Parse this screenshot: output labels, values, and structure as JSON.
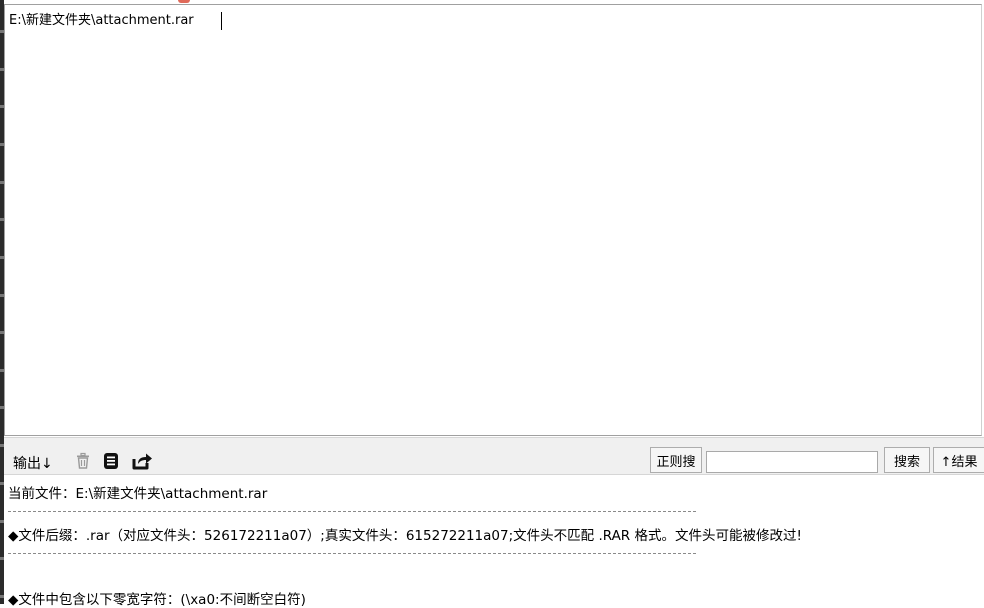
{
  "input": {
    "path": "E:\\新建文件夹\\attachment.rar"
  },
  "toolbar": {
    "output_label": "输出↓",
    "regex_label": "正则搜",
    "search_value": "",
    "search_button": "搜索",
    "results_button": "↑结果"
  },
  "output": {
    "current_file": "当前文件：E:\\新建文件夹\\attachment.rar",
    "suffix_line": "◆文件后缀：.rar（对应文件头：526172211a07）;真实文件头：615272211a07;文件头不匹配 .RAR 格式。文件头可能被修改过!",
    "zero_width_line": "◆文件中包含以下零宽字符：(\\xa0:不间断空白符)"
  },
  "icons": {
    "trash": "trash-icon",
    "document": "document-icon",
    "share": "share-icon"
  },
  "colors": {
    "toolbar_bg": "#f0f0f0",
    "window_edge": "#2b2b2b"
  }
}
